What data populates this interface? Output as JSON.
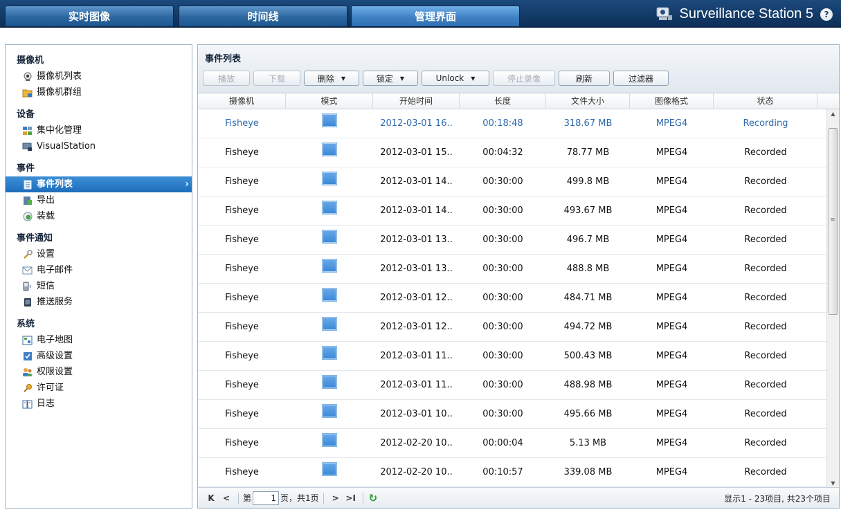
{
  "tabs": [
    {
      "label": "实时图像",
      "active": false
    },
    {
      "label": "时间线",
      "active": false
    },
    {
      "label": "管理界面",
      "active": true
    }
  ],
  "brand": {
    "title": "Surveillance Station 5",
    "help": "?"
  },
  "sidebar": {
    "sections": [
      {
        "title": "摄像机",
        "items": [
          {
            "label": "摄像机列表",
            "icon": "camera-icon"
          },
          {
            "label": "摄像机群组",
            "icon": "folder-camera-icon"
          }
        ]
      },
      {
        "title": "设备",
        "items": [
          {
            "label": "集中化管理",
            "icon": "cms-network-icon"
          },
          {
            "label": "VisualStation",
            "icon": "visualstation-icon"
          }
        ]
      },
      {
        "title": "事件",
        "items": [
          {
            "label": "事件列表",
            "icon": "event-list-icon",
            "selected": true
          },
          {
            "label": "导出",
            "icon": "export-icon"
          },
          {
            "label": "装载",
            "icon": "mount-icon"
          }
        ]
      },
      {
        "title": "事件通知",
        "items": [
          {
            "label": "设置",
            "icon": "wrench-icon"
          },
          {
            "label": "电子邮件",
            "icon": "email-icon"
          },
          {
            "label": "短信",
            "icon": "sms-phone-icon"
          },
          {
            "label": "推送服务",
            "icon": "push-service-icon"
          }
        ]
      },
      {
        "title": "系统",
        "items": [
          {
            "label": "电子地图",
            "icon": "emap-icon"
          },
          {
            "label": "高级设置",
            "icon": "advanced-settings-icon"
          },
          {
            "label": "权限设置",
            "icon": "privilege-users-icon"
          },
          {
            "label": "许可证",
            "icon": "license-key-icon"
          },
          {
            "label": "日志",
            "icon": "log-book-icon"
          }
        ]
      }
    ]
  },
  "main": {
    "title": "事件列表",
    "toolbar": [
      {
        "label": "播放",
        "disabled": true,
        "dropdown": false
      },
      {
        "label": "下载",
        "disabled": true,
        "dropdown": false
      },
      {
        "label": "删除",
        "disabled": false,
        "dropdown": true
      },
      {
        "label": "锁定",
        "disabled": false,
        "dropdown": true
      },
      {
        "label": "Unlock",
        "disabled": false,
        "dropdown": true
      },
      {
        "label": "停止录像",
        "disabled": true,
        "dropdown": false
      },
      {
        "label": "刷新",
        "disabled": false,
        "dropdown": false
      },
      {
        "label": "过滤器",
        "disabled": false,
        "dropdown": false
      }
    ],
    "columns": [
      "摄像机",
      "模式",
      "开始时间",
      "长度",
      "文件大小",
      "图像格式",
      "状态"
    ],
    "rows": [
      {
        "camera": "Fisheye",
        "start": "2012-03-01 16..",
        "length": "00:18:48",
        "size": "318.67 MB",
        "format": "MPEG4",
        "status": "Recording"
      },
      {
        "camera": "Fisheye",
        "start": "2012-03-01 15..",
        "length": "00:04:32",
        "size": "78.77 MB",
        "format": "MPEG4",
        "status": "Recorded"
      },
      {
        "camera": "Fisheye",
        "start": "2012-03-01 14..",
        "length": "00:30:00",
        "size": "499.8 MB",
        "format": "MPEG4",
        "status": "Recorded"
      },
      {
        "camera": "Fisheye",
        "start": "2012-03-01 14..",
        "length": "00:30:00",
        "size": "493.67 MB",
        "format": "MPEG4",
        "status": "Recorded"
      },
      {
        "camera": "Fisheye",
        "start": "2012-03-01 13..",
        "length": "00:30:00",
        "size": "496.7 MB",
        "format": "MPEG4",
        "status": "Recorded"
      },
      {
        "camera": "Fisheye",
        "start": "2012-03-01 13..",
        "length": "00:30:00",
        "size": "488.8 MB",
        "format": "MPEG4",
        "status": "Recorded"
      },
      {
        "camera": "Fisheye",
        "start": "2012-03-01 12..",
        "length": "00:30:00",
        "size": "484.71 MB",
        "format": "MPEG4",
        "status": "Recorded"
      },
      {
        "camera": "Fisheye",
        "start": "2012-03-01 12..",
        "length": "00:30:00",
        "size": "494.72 MB",
        "format": "MPEG4",
        "status": "Recorded"
      },
      {
        "camera": "Fisheye",
        "start": "2012-03-01 11..",
        "length": "00:30:00",
        "size": "500.43 MB",
        "format": "MPEG4",
        "status": "Recorded"
      },
      {
        "camera": "Fisheye",
        "start": "2012-03-01 11..",
        "length": "00:30:00",
        "size": "488.98 MB",
        "format": "MPEG4",
        "status": "Recorded"
      },
      {
        "camera": "Fisheye",
        "start": "2012-03-01 10..",
        "length": "00:30:00",
        "size": "495.66 MB",
        "format": "MPEG4",
        "status": "Recorded"
      },
      {
        "camera": "Fisheye",
        "start": "2012-02-20 10..",
        "length": "00:00:04",
        "size": "5.13 MB",
        "format": "MPEG4",
        "status": "Recorded"
      },
      {
        "camera": "Fisheye",
        "start": "2012-02-20 10..",
        "length": "00:10:57",
        "size": "339.08 MB",
        "format": "MPEG4",
        "status": "Recorded"
      }
    ],
    "pager": {
      "first": "K",
      "prev": "<",
      "page_prefix": "第",
      "page_value": "1",
      "page_suffix": "页，共1页",
      "next": ">",
      "last": ">I",
      "summary": "显示1 - 23项目, 共23个项目"
    }
  },
  "colors": {
    "accent": "#2d6aad",
    "selected": "#1d6dbb",
    "header": "#0d2f58"
  }
}
